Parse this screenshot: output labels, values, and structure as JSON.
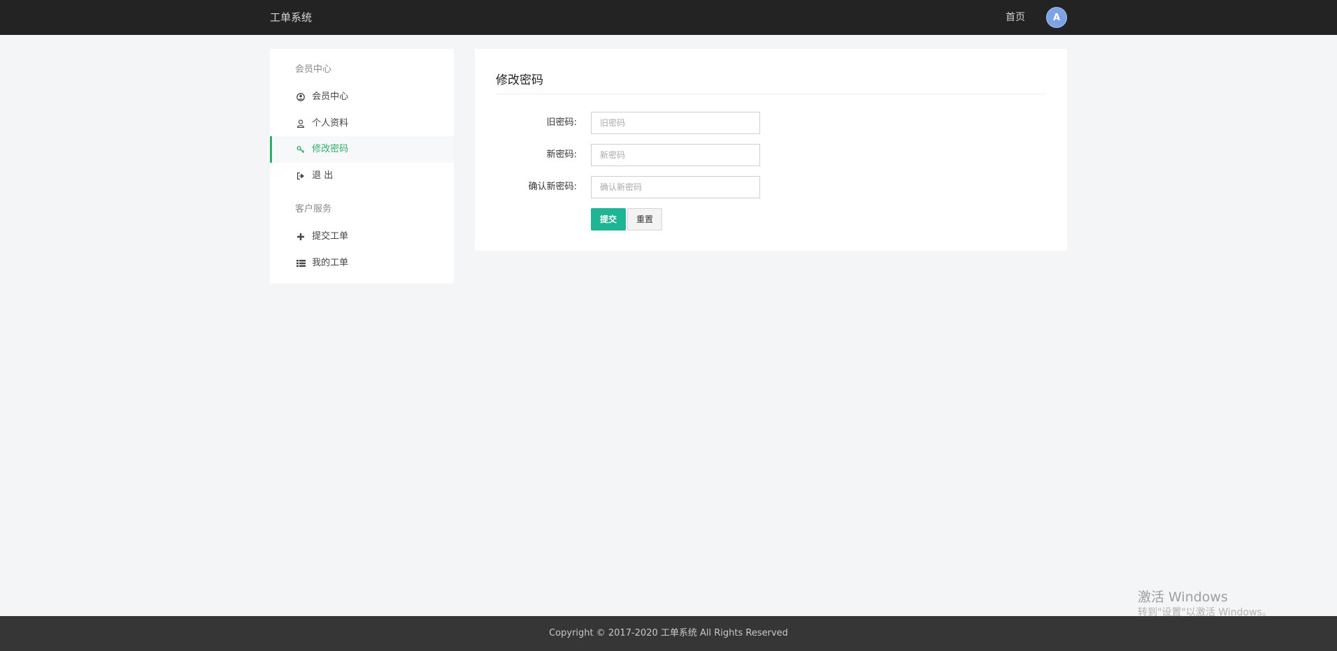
{
  "header": {
    "brand": "工单系统",
    "nav_home": "首页",
    "avatar_letter": "A"
  },
  "sidebar": {
    "groups": [
      {
        "title": "会员中心",
        "items": [
          {
            "label": "会员中心",
            "icon": "user-circle-icon",
            "active": false
          },
          {
            "label": "个人资料",
            "icon": "user-icon",
            "active": false
          },
          {
            "label": "修改密码",
            "icon": "key-icon",
            "active": true
          },
          {
            "label": "退 出",
            "icon": "sign-out-icon",
            "active": false
          }
        ]
      },
      {
        "title": "客户服务",
        "items": [
          {
            "label": "提交工单",
            "icon": "plus-icon",
            "active": false
          },
          {
            "label": "我的工单",
            "icon": "list-icon",
            "active": false
          }
        ]
      }
    ]
  },
  "main": {
    "title": "修改密码",
    "fields": [
      {
        "label": "旧密码:",
        "placeholder": "旧密码",
        "value": ""
      },
      {
        "label": "新密码:",
        "placeholder": "新密码",
        "value": ""
      },
      {
        "label": "确认新密码:",
        "placeholder": "确认新密码",
        "value": ""
      }
    ],
    "submit_label": "提交",
    "reset_label": "重置"
  },
  "footer": {
    "copyright": "Copyright © 2017-2020 工单系统 All Rights Reserved"
  },
  "watermark": {
    "title": "激活 Windows",
    "subtitle": "转到\"设置\"以激活 Windows。"
  },
  "colors": {
    "header_bg": "#232323",
    "accent_green": "#2fae6a",
    "submit_bg": "#1eb495",
    "footer_bg": "#363636",
    "page_bg": "#f4f5f7"
  }
}
